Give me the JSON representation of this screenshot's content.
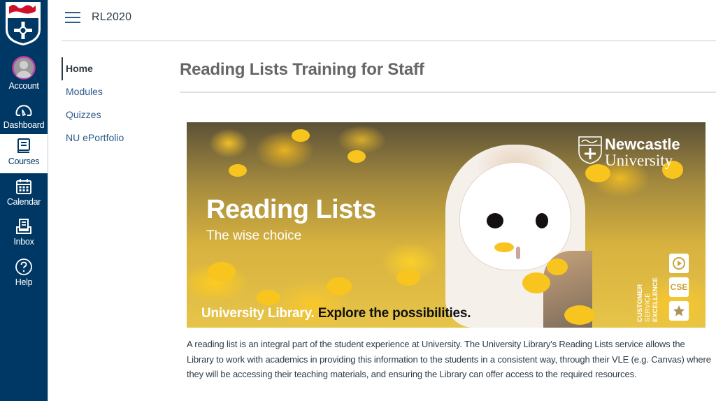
{
  "global_nav": {
    "colors": {
      "background": "#003865",
      "active_background": "#ffffff",
      "account_ring": "#c23fa5"
    },
    "items": [
      {
        "id": "account",
        "label": "Account",
        "icon": "avatar-icon",
        "active": false
      },
      {
        "id": "dashboard",
        "label": "Dashboard",
        "icon": "dashboard-gauge-icon",
        "active": false
      },
      {
        "id": "courses",
        "label": "Courses",
        "icon": "book-icon",
        "active": true
      },
      {
        "id": "calendar",
        "label": "Calendar",
        "icon": "calendar-icon",
        "active": false
      },
      {
        "id": "inbox",
        "label": "Inbox",
        "icon": "inbox-icon",
        "active": false
      },
      {
        "id": "help",
        "label": "Help",
        "icon": "question-circle-icon",
        "active": false
      }
    ]
  },
  "header": {
    "menu_icon": "hamburger-icon",
    "breadcrumb": "RL2020"
  },
  "course_nav": {
    "items": [
      {
        "label": "Home",
        "active": true
      },
      {
        "label": "Modules",
        "active": false
      },
      {
        "label": "Quizzes",
        "active": false
      },
      {
        "label": "NU ePortfolio",
        "active": false
      }
    ]
  },
  "main": {
    "page_title": "Reading Lists Training for Staff",
    "banner": {
      "title": "Reading Lists",
      "subtitle": "The wise choice",
      "tagline_light": "University Library.",
      "tagline_dark": " Explore the possibilities.",
      "logo_line1": "Newcastle",
      "logo_line2": "University",
      "cse_lines": [
        "CUSTOMER",
        "SERVICE",
        "EXCELLENCE"
      ],
      "cse_badges": [
        "play-icon",
        "CSE",
        "star-icon"
      ],
      "cse_badge_text": "CSE"
    },
    "body_text": "A reading list is an integral part of the student experience at University. The University Library's Reading Lists service allows the Library to work with academics in providing this information to the students in a consistent way, through their VLE (e.g. Canvas) where they will be accessing their teaching materials, and ensuring the Library can offer access to the required resources."
  }
}
